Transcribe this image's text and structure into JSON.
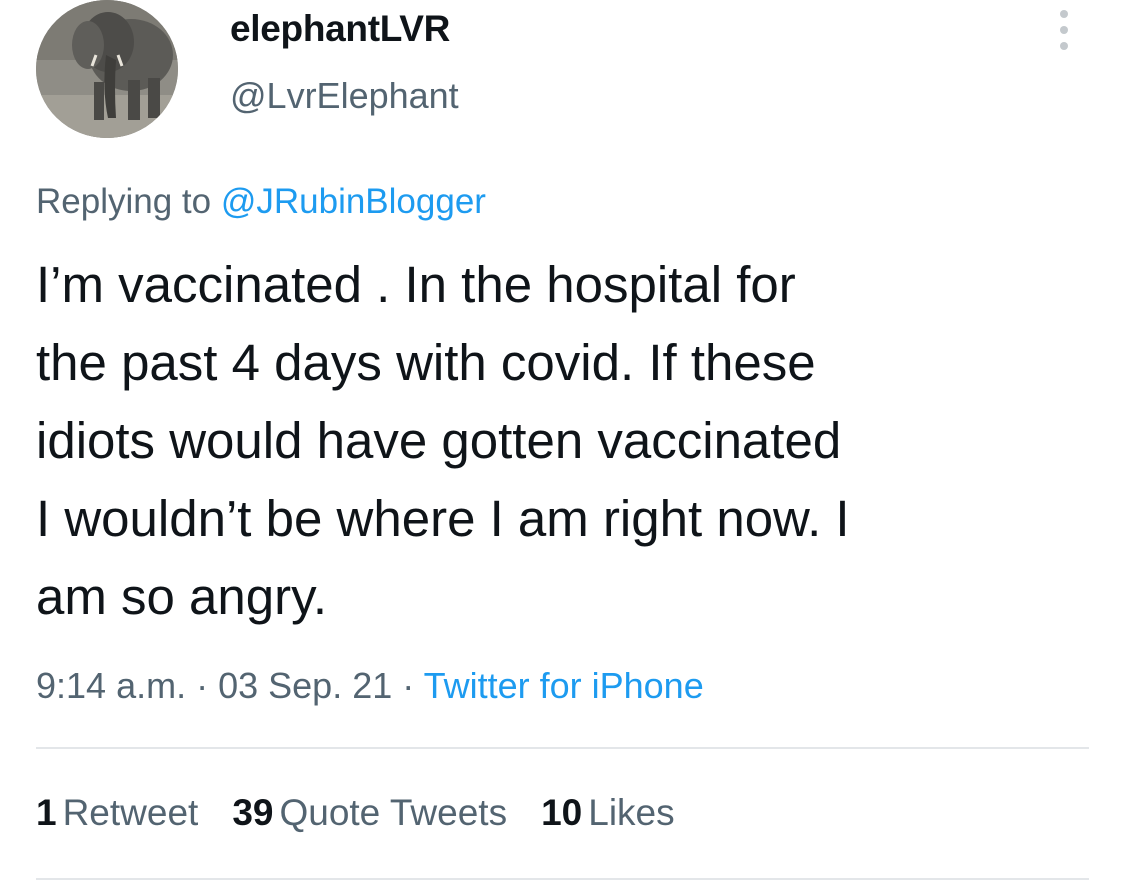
{
  "user": {
    "display_name": "elephantLVR",
    "handle": "@LvrElephant",
    "avatar_icon": "elephant-avatar"
  },
  "reply": {
    "prefix": "Replying to ",
    "mention": "@JRubinBlogger"
  },
  "tweet": {
    "lines": [
      "I’m vaccinated . In the hospital for",
      "the past 4 days with covid. If these",
      "idiots would have gotten vaccinated",
      "I wouldn’t be where I am right now. I",
      "am so angry."
    ]
  },
  "meta": {
    "time": "9:14 a.m.",
    "sep1": " · ",
    "date": "03 Sep. 21",
    "sep2": " · ",
    "source": "Twitter for iPhone"
  },
  "stats": {
    "retweets_count": "1",
    "retweets_label": "Retweet",
    "quotes_count": "39",
    "quotes_label": "Quote Tweets",
    "likes_count": "10",
    "likes_label": "Likes"
  },
  "colors": {
    "link": "#1d9bf0",
    "secondary_text": "#536471",
    "primary_text": "#0f1419",
    "divider": "#e3e6e9"
  }
}
